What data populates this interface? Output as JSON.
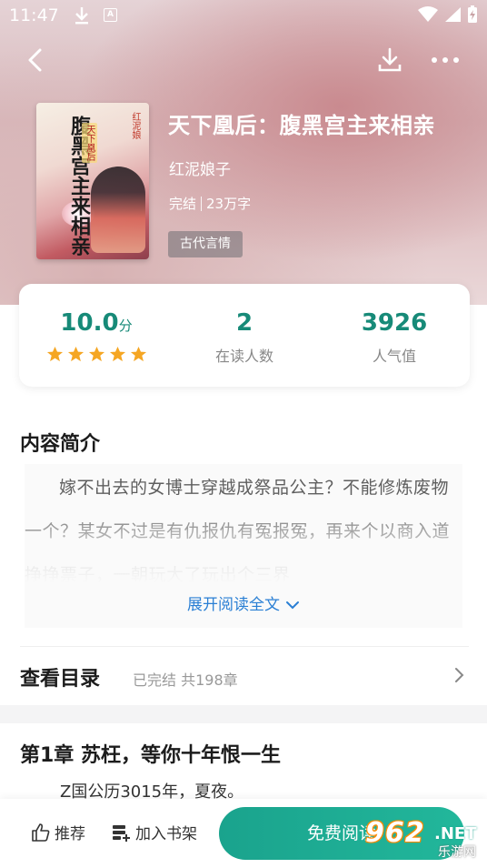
{
  "status_bar": {
    "time": "11:47"
  },
  "book": {
    "title": "天下凰后：腹黑宫主来相亲",
    "author": "红泥娘子",
    "status": "完结",
    "word_count": "23万字",
    "tag": "古代言情",
    "cover": {
      "title": "腹黑宫主来相亲",
      "badge": "天下凰后",
      "author": "红泥娘"
    }
  },
  "stats": {
    "score_value": "10.0",
    "score_unit": "分",
    "rating_stars": 5,
    "readers_value": "2",
    "readers_label": "在读人数",
    "popularity_value": "3926",
    "popularity_label": "人气值"
  },
  "intro": {
    "heading": "内容简介",
    "text": "嫁不出去的女博士穿越成祭品公主？不能修炼废物一个？某女不过是有仇报仇有冤报冤，再来个以商入道挣挣票子，一朝玩大了玩出个三界",
    "expand_label": "展开阅读全文"
  },
  "toc": {
    "heading": "查看目录",
    "status": "已完结 共198章"
  },
  "chapter": {
    "title": "第1章 苏枉，等你十年恨一生",
    "first_line": "Z国公历3015年，夏夜。"
  },
  "bottom_bar": {
    "recommend_label": "推荐",
    "shelf_label": "加入书架",
    "read_label": "免费阅读"
  },
  "watermark": {
    "number": "962",
    "suffix": ".NET",
    "site": "乐游网"
  },
  "colors": {
    "accent": "#178a78",
    "button": "#1aa38d",
    "link": "#2a7fd4",
    "star": "#f5a623"
  },
  "icons": [
    "back-arrow-icon",
    "download-icon",
    "more-icon",
    "star-icon",
    "chevron-down-icon",
    "chevron-right-icon",
    "thumbs-up-icon",
    "bookshelf-add-icon"
  ]
}
